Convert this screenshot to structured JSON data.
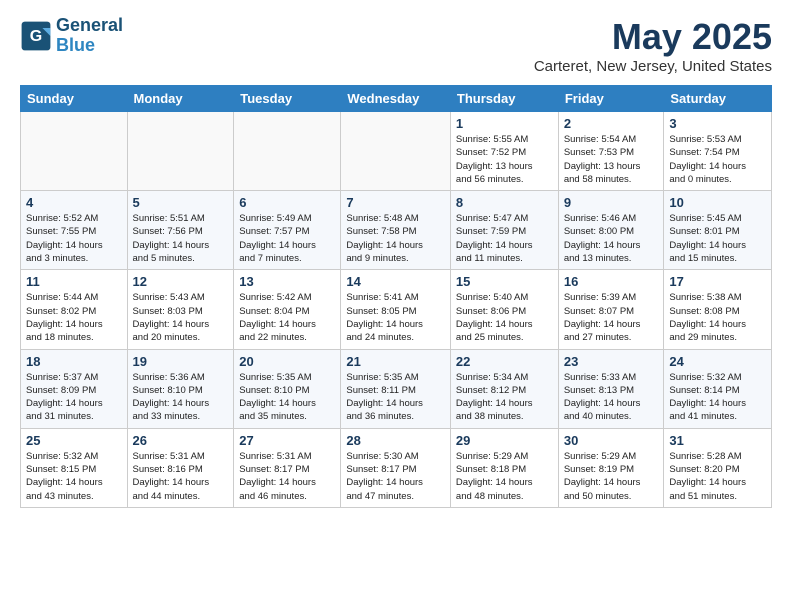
{
  "header": {
    "logo_line1": "General",
    "logo_line2": "Blue",
    "month": "May 2025",
    "location": "Carteret, New Jersey, United States"
  },
  "weekdays": [
    "Sunday",
    "Monday",
    "Tuesday",
    "Wednesday",
    "Thursday",
    "Friday",
    "Saturday"
  ],
  "weeks": [
    [
      {
        "day": "",
        "info": ""
      },
      {
        "day": "",
        "info": ""
      },
      {
        "day": "",
        "info": ""
      },
      {
        "day": "",
        "info": ""
      },
      {
        "day": "1",
        "info": "Sunrise: 5:55 AM\nSunset: 7:52 PM\nDaylight: 13 hours\nand 56 minutes."
      },
      {
        "day": "2",
        "info": "Sunrise: 5:54 AM\nSunset: 7:53 PM\nDaylight: 13 hours\nand 58 minutes."
      },
      {
        "day": "3",
        "info": "Sunrise: 5:53 AM\nSunset: 7:54 PM\nDaylight: 14 hours\nand 0 minutes."
      }
    ],
    [
      {
        "day": "4",
        "info": "Sunrise: 5:52 AM\nSunset: 7:55 PM\nDaylight: 14 hours\nand 3 minutes."
      },
      {
        "day": "5",
        "info": "Sunrise: 5:51 AM\nSunset: 7:56 PM\nDaylight: 14 hours\nand 5 minutes."
      },
      {
        "day": "6",
        "info": "Sunrise: 5:49 AM\nSunset: 7:57 PM\nDaylight: 14 hours\nand 7 minutes."
      },
      {
        "day": "7",
        "info": "Sunrise: 5:48 AM\nSunset: 7:58 PM\nDaylight: 14 hours\nand 9 minutes."
      },
      {
        "day": "8",
        "info": "Sunrise: 5:47 AM\nSunset: 7:59 PM\nDaylight: 14 hours\nand 11 minutes."
      },
      {
        "day": "9",
        "info": "Sunrise: 5:46 AM\nSunset: 8:00 PM\nDaylight: 14 hours\nand 13 minutes."
      },
      {
        "day": "10",
        "info": "Sunrise: 5:45 AM\nSunset: 8:01 PM\nDaylight: 14 hours\nand 15 minutes."
      }
    ],
    [
      {
        "day": "11",
        "info": "Sunrise: 5:44 AM\nSunset: 8:02 PM\nDaylight: 14 hours\nand 18 minutes."
      },
      {
        "day": "12",
        "info": "Sunrise: 5:43 AM\nSunset: 8:03 PM\nDaylight: 14 hours\nand 20 minutes."
      },
      {
        "day": "13",
        "info": "Sunrise: 5:42 AM\nSunset: 8:04 PM\nDaylight: 14 hours\nand 22 minutes."
      },
      {
        "day": "14",
        "info": "Sunrise: 5:41 AM\nSunset: 8:05 PM\nDaylight: 14 hours\nand 24 minutes."
      },
      {
        "day": "15",
        "info": "Sunrise: 5:40 AM\nSunset: 8:06 PM\nDaylight: 14 hours\nand 25 minutes."
      },
      {
        "day": "16",
        "info": "Sunrise: 5:39 AM\nSunset: 8:07 PM\nDaylight: 14 hours\nand 27 minutes."
      },
      {
        "day": "17",
        "info": "Sunrise: 5:38 AM\nSunset: 8:08 PM\nDaylight: 14 hours\nand 29 minutes."
      }
    ],
    [
      {
        "day": "18",
        "info": "Sunrise: 5:37 AM\nSunset: 8:09 PM\nDaylight: 14 hours\nand 31 minutes."
      },
      {
        "day": "19",
        "info": "Sunrise: 5:36 AM\nSunset: 8:10 PM\nDaylight: 14 hours\nand 33 minutes."
      },
      {
        "day": "20",
        "info": "Sunrise: 5:35 AM\nSunset: 8:10 PM\nDaylight: 14 hours\nand 35 minutes."
      },
      {
        "day": "21",
        "info": "Sunrise: 5:35 AM\nSunset: 8:11 PM\nDaylight: 14 hours\nand 36 minutes."
      },
      {
        "day": "22",
        "info": "Sunrise: 5:34 AM\nSunset: 8:12 PM\nDaylight: 14 hours\nand 38 minutes."
      },
      {
        "day": "23",
        "info": "Sunrise: 5:33 AM\nSunset: 8:13 PM\nDaylight: 14 hours\nand 40 minutes."
      },
      {
        "day": "24",
        "info": "Sunrise: 5:32 AM\nSunset: 8:14 PM\nDaylight: 14 hours\nand 41 minutes."
      }
    ],
    [
      {
        "day": "25",
        "info": "Sunrise: 5:32 AM\nSunset: 8:15 PM\nDaylight: 14 hours\nand 43 minutes."
      },
      {
        "day": "26",
        "info": "Sunrise: 5:31 AM\nSunset: 8:16 PM\nDaylight: 14 hours\nand 44 minutes."
      },
      {
        "day": "27",
        "info": "Sunrise: 5:31 AM\nSunset: 8:17 PM\nDaylight: 14 hours\nand 46 minutes."
      },
      {
        "day": "28",
        "info": "Sunrise: 5:30 AM\nSunset: 8:17 PM\nDaylight: 14 hours\nand 47 minutes."
      },
      {
        "day": "29",
        "info": "Sunrise: 5:29 AM\nSunset: 8:18 PM\nDaylight: 14 hours\nand 48 minutes."
      },
      {
        "day": "30",
        "info": "Sunrise: 5:29 AM\nSunset: 8:19 PM\nDaylight: 14 hours\nand 50 minutes."
      },
      {
        "day": "31",
        "info": "Sunrise: 5:28 AM\nSunset: 8:20 PM\nDaylight: 14 hours\nand 51 minutes."
      }
    ]
  ]
}
